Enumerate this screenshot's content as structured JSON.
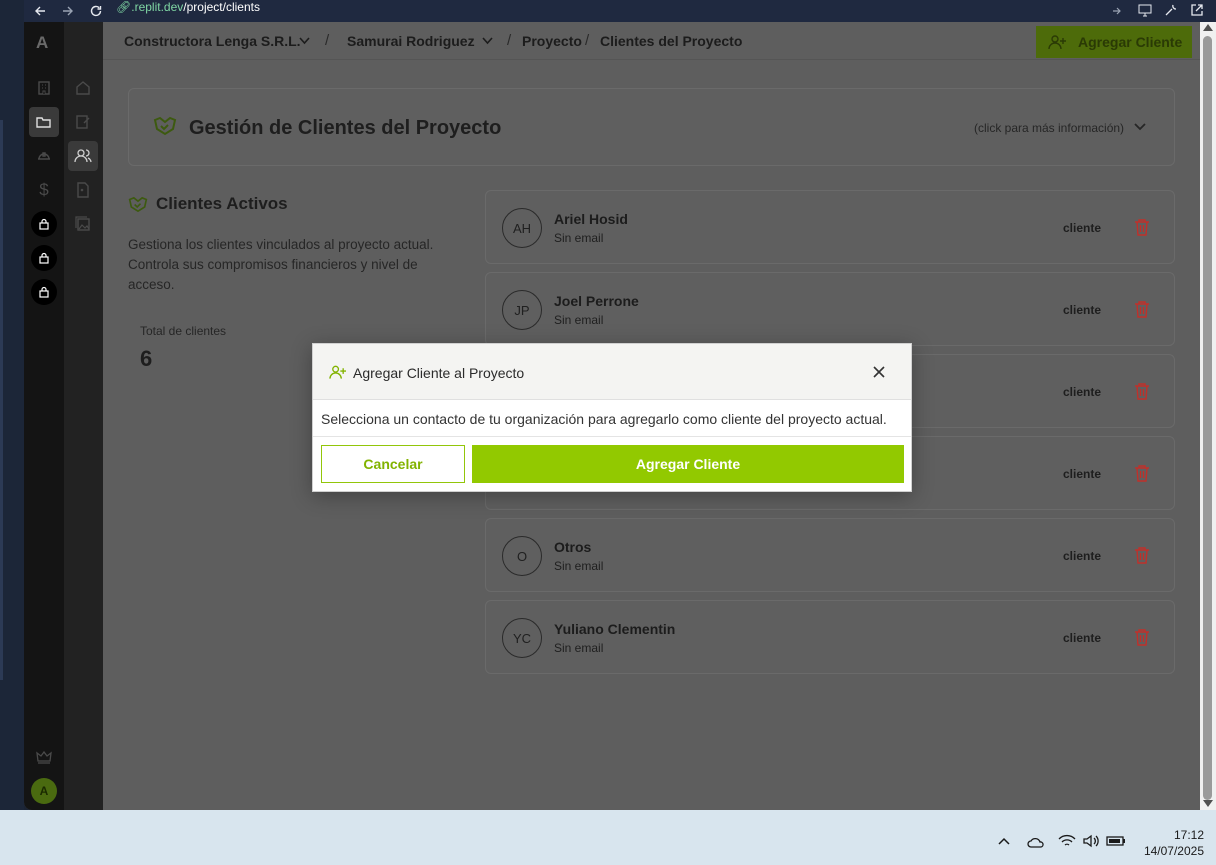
{
  "browser": {
    "url_host": ".replit.dev",
    "url_path": "/project/clients"
  },
  "header": {
    "breadcrumb": {
      "org": "Constructora Lenga S.R.L.",
      "user": "Samurai Rodriguez",
      "section": "Proyecto",
      "page": "Clientes del Proyecto",
      "separator": "/"
    },
    "add_button_label": "Agregar Cliente"
  },
  "sidebar": {
    "logo_letter": "A",
    "avatar_letter": "A"
  },
  "info_card": {
    "title": "Gestión de Clientes del Proyecto",
    "hint": "(click para más información)"
  },
  "active_clients": {
    "title": "Clientes Activos",
    "description": "Gestiona los clientes vinculados al proyecto actual. Controla sus compromisos financieros y nivel de acceso.",
    "total_label": "Total de clientes",
    "total_value": "6"
  },
  "clients": [
    {
      "initials": "AH",
      "name": "Ariel Hosid",
      "email": "Sin email",
      "role": "cliente"
    },
    {
      "initials": "JP",
      "name": "Joel Perrone",
      "email": "Sin email",
      "role": "cliente"
    },
    {
      "initials": "",
      "name": "",
      "email": "",
      "role": "cliente"
    },
    {
      "initials": "",
      "name": "",
      "email": "",
      "role": "cliente"
    },
    {
      "initials": "O",
      "name": "Otros",
      "email": "Sin email",
      "role": "cliente"
    },
    {
      "initials": "YC",
      "name": "Yuliano Clementin",
      "email": "Sin email",
      "role": "cliente"
    }
  ],
  "modal": {
    "title": "Agregar Cliente al Proyecto",
    "body": "Selecciona un contacto de tu organización para agregarlo como cliente del proyecto actual.",
    "cancel_label": "Cancelar",
    "confirm_label": "Agregar Cliente"
  },
  "taskbar": {
    "time": "17:12",
    "date": "14/07/2025"
  },
  "colors": {
    "accent": "#92c900",
    "danger": "#c0302a"
  }
}
